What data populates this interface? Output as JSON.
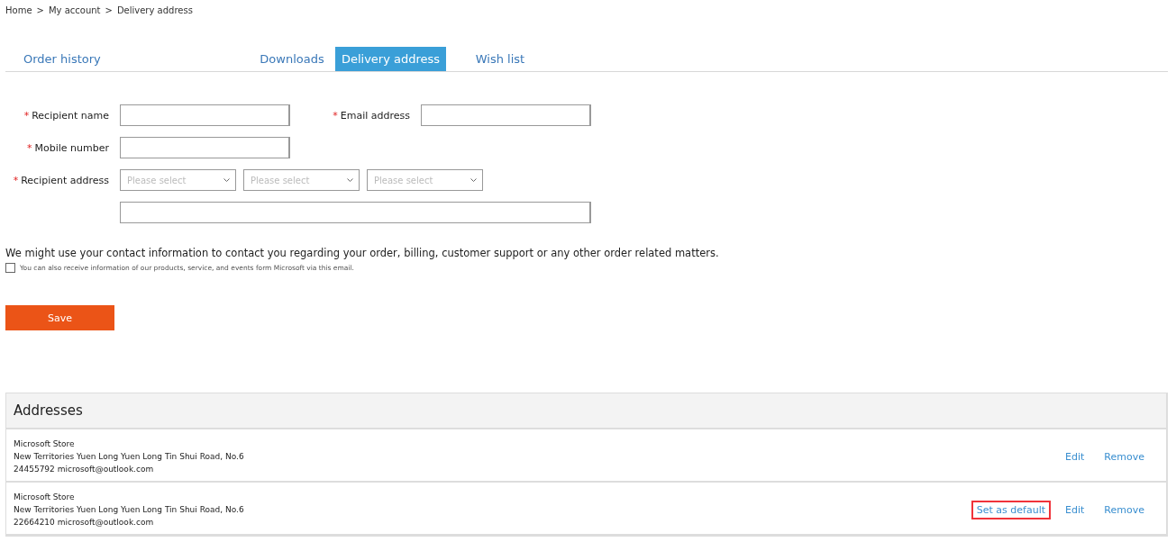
{
  "breadcrumb": [
    "Home",
    "My account",
    "Delivery address"
  ],
  "breadcrumb_separator": ">",
  "tabs": [
    {
      "label": "Order history",
      "selected": false
    },
    {
      "label": "Downloads",
      "selected": false
    },
    {
      "label": "Delivery address",
      "selected": true
    },
    {
      "label": "Wish list",
      "selected": false
    }
  ],
  "form": {
    "required_mark": "*",
    "recipient_name": {
      "label": "Recipient name"
    },
    "email_address": {
      "label": "Email address"
    },
    "mobile_number": {
      "label": "Mobile number"
    },
    "recipient_address": {
      "label": "Recipient address",
      "selects": [
        "Please select",
        "Please select",
        "Please select"
      ]
    }
  },
  "notice": "We might use your contact information to contact you regarding your order, billing, customer support or any other order related matters.",
  "subscribe": {
    "label": "You can also receive information of our products, service, and events form Microsoft via this email.",
    "checked": false
  },
  "save_button": "Save",
  "addresses": {
    "title": "Addresses",
    "items": [
      {
        "name": "Microsoft Store",
        "address": "New Territories Yuen Long Yuen Long Tin Shui Road, No.6",
        "contact": "24455792 microsoft@outlook.com",
        "actions": [
          {
            "label": "Edit",
            "highlighted": false
          },
          {
            "label": "Remove",
            "highlighted": false
          }
        ]
      },
      {
        "name": "Microsoft Store",
        "address": "New Territories Yuen Long Yuen Long Tin Shui Road, No.6",
        "contact": "22664210 microsoft@outlook.com",
        "actions": [
          {
            "label": "Set as default",
            "highlighted": true
          },
          {
            "label": "Edit",
            "highlighted": false
          },
          {
            "label": "Remove",
            "highlighted": false
          }
        ]
      }
    ]
  }
}
